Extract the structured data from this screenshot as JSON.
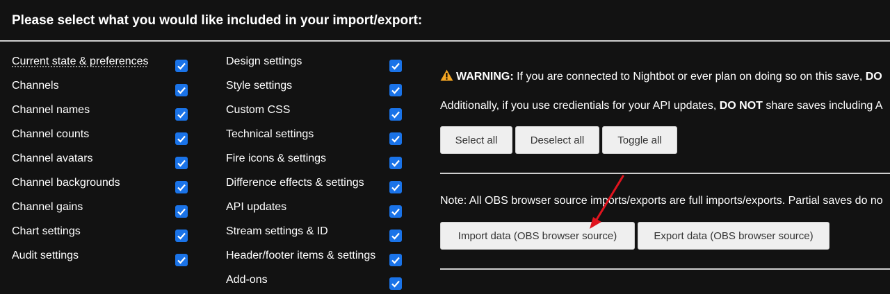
{
  "header": {
    "title": "Please select what you would like included in your import/export:"
  },
  "left_column": [
    {
      "label": "Current state & preferences",
      "checked": true
    },
    {
      "label": "Channels",
      "checked": true
    },
    {
      "label": "Channel names",
      "checked": true
    },
    {
      "label": "Channel counts",
      "checked": true
    },
    {
      "label": "Channel avatars",
      "checked": true
    },
    {
      "label": "Channel backgrounds",
      "checked": true
    },
    {
      "label": "Channel gains",
      "checked": true
    },
    {
      "label": "Chart settings",
      "checked": true
    },
    {
      "label": "Audit settings",
      "checked": true
    }
  ],
  "middle_column": [
    {
      "label": "Design settings",
      "checked": true
    },
    {
      "label": "Style settings",
      "checked": true
    },
    {
      "label": "Custom CSS",
      "checked": true
    },
    {
      "label": "Technical settings",
      "checked": true
    },
    {
      "label": "Fire icons & settings",
      "checked": true
    },
    {
      "label": "Difference effects & settings",
      "checked": true
    },
    {
      "label": "API updates",
      "checked": true
    },
    {
      "label": "Stream settings & ID",
      "checked": true
    },
    {
      "label": "Header/footer items & settings",
      "checked": true
    },
    {
      "label": "Add-ons",
      "checked": true
    }
  ],
  "warning": {
    "icon": "warning-icon",
    "bold_label": "WARNING:",
    "text": " If you are connected to Nightbot or ever plan on doing so on this save, ",
    "bold_tail": "DO"
  },
  "additional": {
    "text_before": "Additionally, if you use credientials for your API updates, ",
    "bold": "DO NOT",
    "text_after": " share saves including A"
  },
  "select_buttons": {
    "select_all": "Select all",
    "deselect_all": "Deselect all",
    "toggle_all": "Toggle all"
  },
  "obs_note": "Note: All OBS browser source imports/exports are full imports/exports. Partial saves do no",
  "obs_buttons": {
    "import": "Import data (OBS browser source)",
    "export": "Export data (OBS browser source)"
  },
  "colors": {
    "background": "#121212",
    "checkbox": "#1a73e8",
    "warning": "#f5a623",
    "arrow": "#e0141e",
    "button_bg": "#efefef"
  }
}
